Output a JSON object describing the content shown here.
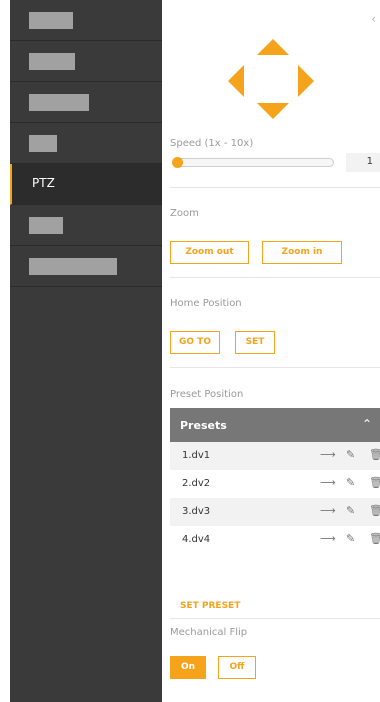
{
  "sidebar": {
    "items": [
      {
        "label": "",
        "blurred": true,
        "blur_width": 44
      },
      {
        "label": "",
        "blurred": true,
        "blur_width": 46
      },
      {
        "label": "",
        "blurred": true,
        "blur_width": 60
      },
      {
        "label": "",
        "blurred": true,
        "blur_width": 28
      },
      {
        "label": "PTZ",
        "active": true
      },
      {
        "label": "",
        "blurred": true,
        "blur_width": 34
      },
      {
        "label": "",
        "blurred": true,
        "blur_width": 88
      }
    ]
  },
  "panel": {
    "collapse_icon": "chevron-left-icon",
    "speed": {
      "label": "Speed (1x - 10x)",
      "value": "1",
      "fraction": 0.0
    },
    "zoom": {
      "label": "Zoom",
      "zoom_out": "Zoom out",
      "zoom_in": "Zoom in"
    },
    "home": {
      "label": "Home Position",
      "goto": "GO TO",
      "set": "SET"
    },
    "preset": {
      "label": "Preset Position",
      "header": "Presets",
      "items": [
        {
          "name": "1.dv1"
        },
        {
          "name": "2.dv2"
        },
        {
          "name": "3.dv3"
        },
        {
          "name": "4.dv4"
        }
      ],
      "set_preset": "SET PRESET"
    },
    "flip": {
      "label": "Mechanical Flip",
      "on": "On",
      "off": "Off",
      "selected": "On"
    }
  },
  "colors": {
    "accent": "#f5a31a",
    "sidebar": "#3a3a3a",
    "sidebar_active": "#2c2c2c",
    "presets_header": "#777777"
  }
}
